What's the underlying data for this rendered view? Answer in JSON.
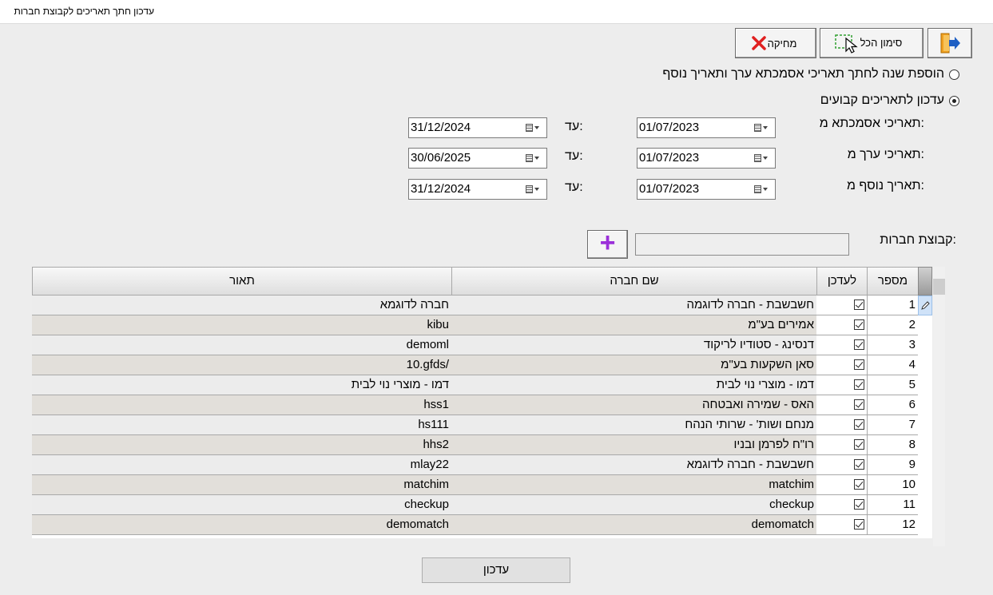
{
  "window": {
    "title": "עדכון חתך תאריכים לקבוצת חברות"
  },
  "toolbar": {
    "mark_all_label": "סימון הכל",
    "delete_label": "מחיקה"
  },
  "options": {
    "add_year": "הוספת שנה לחתך תאריכי אסמכתא ערך ותאריך נוסף",
    "fixed_dates": "עדכון לתאריכים קבועים",
    "selected": "fixed_dates"
  },
  "dates": {
    "to_label": "עד:",
    "rows": [
      {
        "label": "תאריכי אסמכתא מ:",
        "from": "01/07/2023",
        "to": "31/12/2024"
      },
      {
        "label": "תאריכי ערך מ:",
        "from": "01/07/2023",
        "to": "30/06/2025"
      },
      {
        "label": "תאריך נוסף מ:",
        "from": "01/07/2023",
        "to": "31/12/2024"
      }
    ]
  },
  "group": {
    "label": "קבוצת חברות:",
    "value": ""
  },
  "grid": {
    "headers": {
      "number": "מספר",
      "update": "לעדכן",
      "company": "שם חברה",
      "description": "תאור"
    },
    "rows": [
      {
        "number": "1",
        "company": "חשבשבת - חברה לדוגמה",
        "description": "חברה לדוגמא"
      },
      {
        "number": "2",
        "company": "אמירים בע\"מ",
        "description": "kibu"
      },
      {
        "number": "3",
        "company": "דנסינג - סטודיו לריקוד",
        "description": "demoml"
      },
      {
        "number": "4",
        "company": "סאן השקעות בע\"מ",
        "description": "10.gfds/"
      },
      {
        "number": "5",
        "company": "דמו - מוצרי נוי לבית",
        "description": "דמו - מוצרי נוי לבית"
      },
      {
        "number": "6",
        "company": "האס - שמירה ואבטחה",
        "description": "hss1"
      },
      {
        "number": "7",
        "company": "מנחם ושות' - שרותי הנהח",
        "description": "hs111"
      },
      {
        "number": "8",
        "company": "רו\"ח לפרמן ובניו",
        "description": "hhs2"
      },
      {
        "number": "9",
        "company": "חשבשבת - חברה לדוגמא",
        "description": "mlay22"
      },
      {
        "number": "10",
        "company": "matchim",
        "description": "matchim"
      },
      {
        "number": "11",
        "company": "checkup",
        "description": "checkup"
      },
      {
        "number": "12",
        "company": "demomatch",
        "description": "demomatch"
      }
    ]
  },
  "update_button": "עדכון"
}
